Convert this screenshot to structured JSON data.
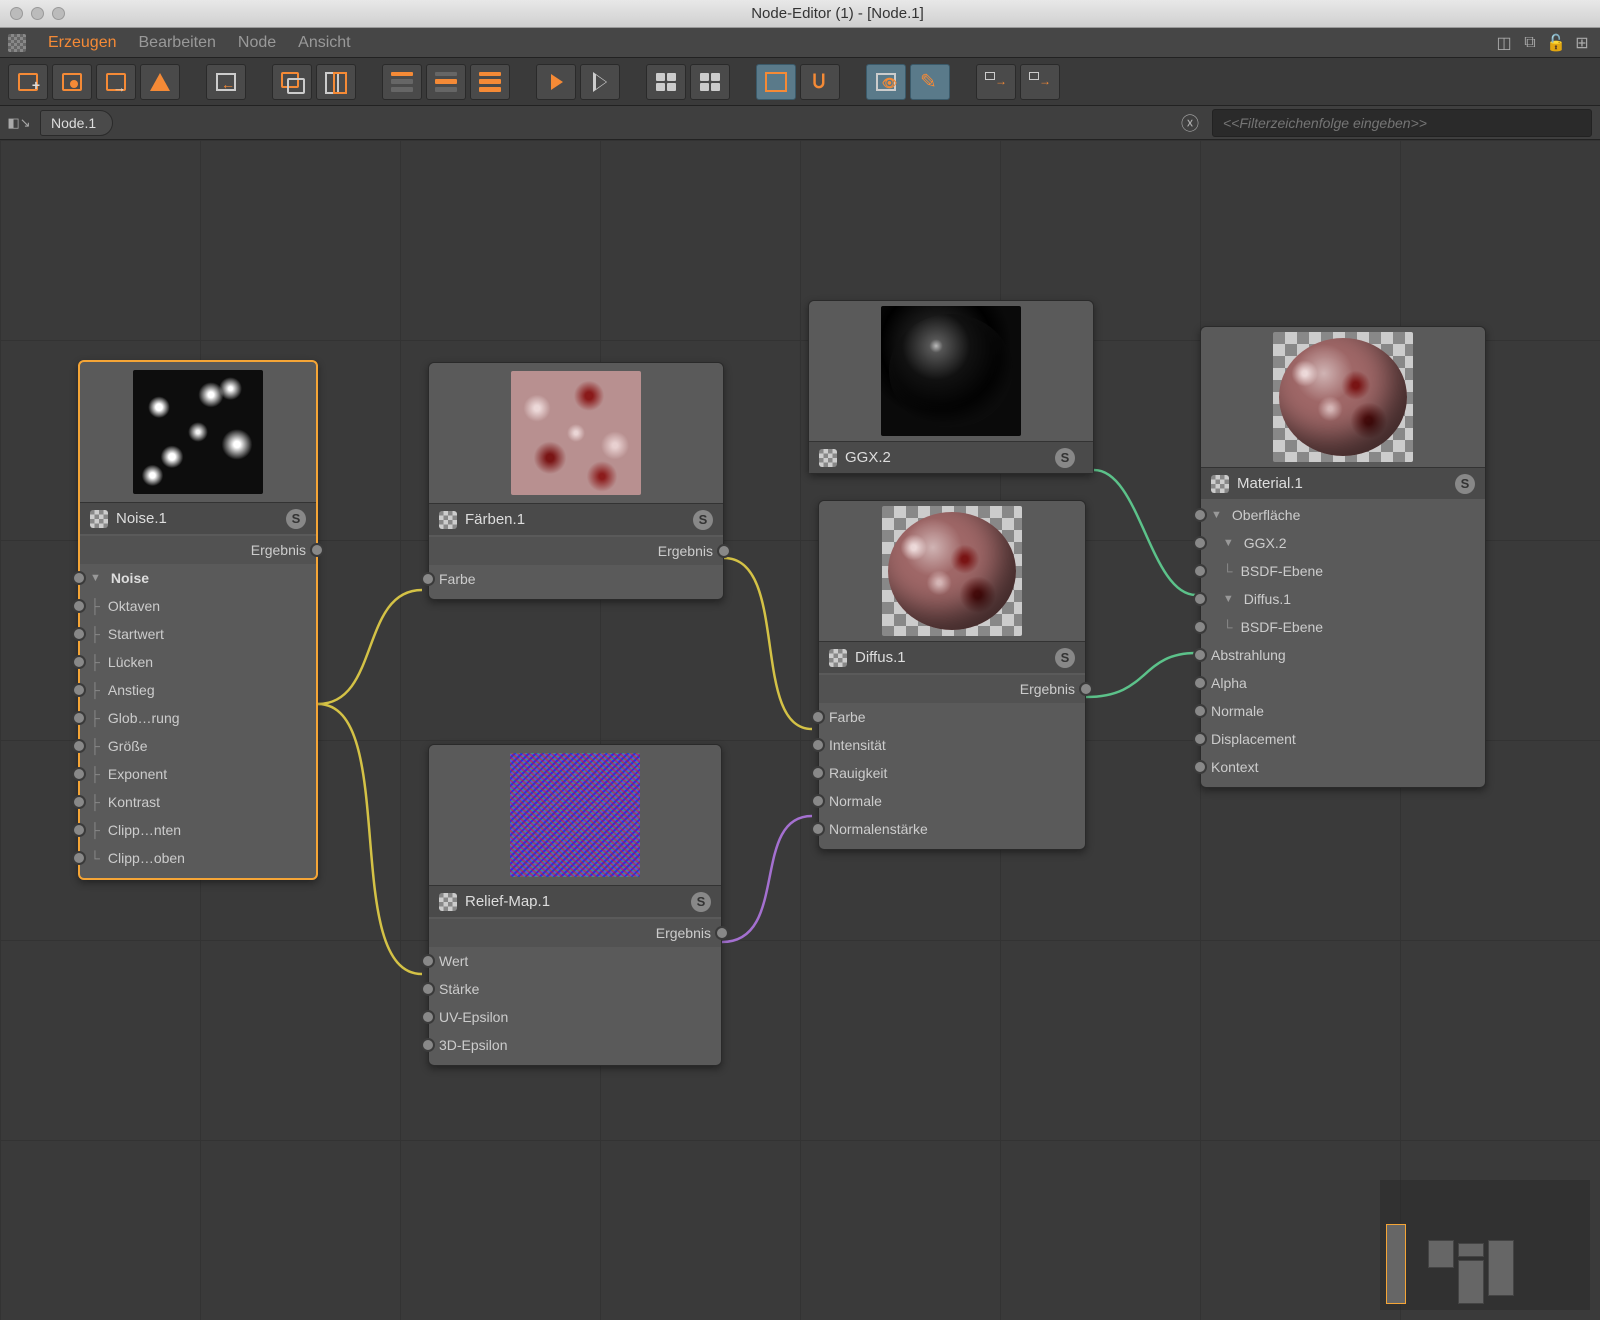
{
  "window": {
    "title": "Node-Editor (1) - [Node.1]"
  },
  "menu": {
    "items": [
      "Erzeugen",
      "Bearbeiten",
      "Node",
      "Ansicht"
    ],
    "active_index": 0
  },
  "breadcrumb": {
    "label": "Node.1"
  },
  "filter": {
    "placeholder": "<<Filterzeichenfolge eingeben>>"
  },
  "nodes": {
    "noise": {
      "title": "Noise.1",
      "outputs": [
        "Ergebnis"
      ],
      "group": "Noise",
      "inputs": [
        "Oktaven",
        "Startwert",
        "Lücken",
        "Anstieg",
        "Glob…rung",
        "Größe",
        "Exponent",
        "Kontrast",
        "Clipp…nten",
        "Clipp…oben"
      ]
    },
    "farben": {
      "title": "Färben.1",
      "outputs": [
        "Ergebnis"
      ],
      "inputs": [
        "Farbe"
      ]
    },
    "relief": {
      "title": "Relief-Map.1",
      "outputs": [
        "Ergebnis"
      ],
      "inputs": [
        "Wert",
        "Stärke",
        "UV-Epsilon",
        "3D-Epsilon"
      ]
    },
    "ggx": {
      "title": "GGX.2"
    },
    "diffus": {
      "title": "Diffus.1",
      "outputs": [
        "Ergebnis"
      ],
      "inputs": [
        "Farbe",
        "Intensität",
        "Rauigkeit",
        "Normale",
        "Normalenstärke"
      ]
    },
    "material": {
      "title": "Material.1",
      "tree": {
        "root": "Oberfläche",
        "ggx": "GGX.2",
        "ggx_leaf": "BSDF-Ebene",
        "diffus": "Diffus.1",
        "diffus_leaf": "BSDF-Ebene"
      },
      "inputs": [
        "Abstrahlung",
        "Alpha",
        "Normale",
        "Displacement",
        "Kontext"
      ]
    }
  }
}
